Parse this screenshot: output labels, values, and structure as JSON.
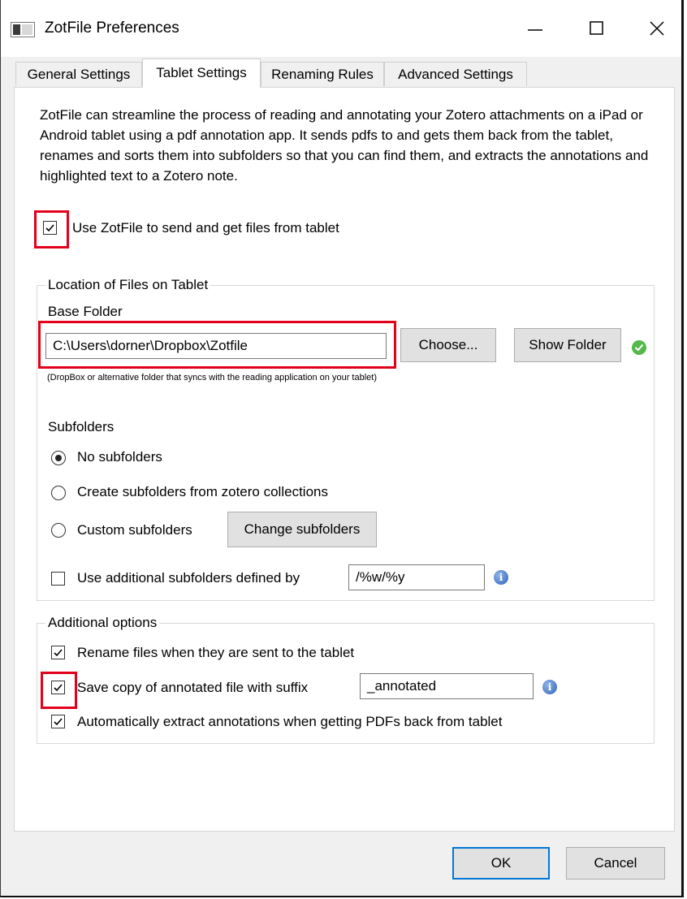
{
  "window": {
    "title": "ZotFile Preferences"
  },
  "tabs": [
    {
      "label": "General Settings"
    },
    {
      "label": "Tablet Settings"
    },
    {
      "label": "Renaming Rules"
    },
    {
      "label": "Advanced Settings"
    }
  ],
  "active_tab": "Tablet Settings",
  "intro_text": "ZotFile can streamline the process of reading and annotating your Zotero attachments on a iPad or Android tablet using a pdf annotation app. It sends pdfs to and gets them back from the tablet, renames and sorts them into subfolders so that you can find them, and extracts the annotations and highlighted text to a Zotero note.",
  "use_tablet": {
    "label": "Use ZotFile to send and get files from tablet",
    "checked": true
  },
  "location_group": {
    "legend": "Location of Files on Tablet",
    "base_folder_label": "Base Folder",
    "base_folder_value": "C:\\Users\\dorner\\Dropbox\\Zotfile",
    "choose_button": "Choose...",
    "show_folder_button": "Show Folder",
    "hint": "(DropBox or alternative folder that syncs with the reading application on your tablet)",
    "subfolders_label": "Subfolders",
    "radio_no_subfolders": "No subfolders",
    "radio_collections": "Create subfolders from zotero collections",
    "radio_custom": "Custom subfolders",
    "change_subfolders_button": "Change subfolders",
    "additional_subfolders_label": "Use additional subfolders defined by",
    "additional_subfolders_value": "/%w/%y",
    "selected_radio": "No subfolders"
  },
  "options_group": {
    "legend": "Additional options",
    "rename_label": "Rename files when they are sent to the tablet",
    "save_copy_label": "Save copy of annotated file with suffix",
    "suffix_value": "_annotated",
    "extract_label": "Automatically extract annotations when getting PDFs back from tablet"
  },
  "footer": {
    "ok": "OK",
    "cancel": "Cancel"
  },
  "colors": {
    "highlight": "#e3001b",
    "default_button_border": "#0078d7"
  }
}
